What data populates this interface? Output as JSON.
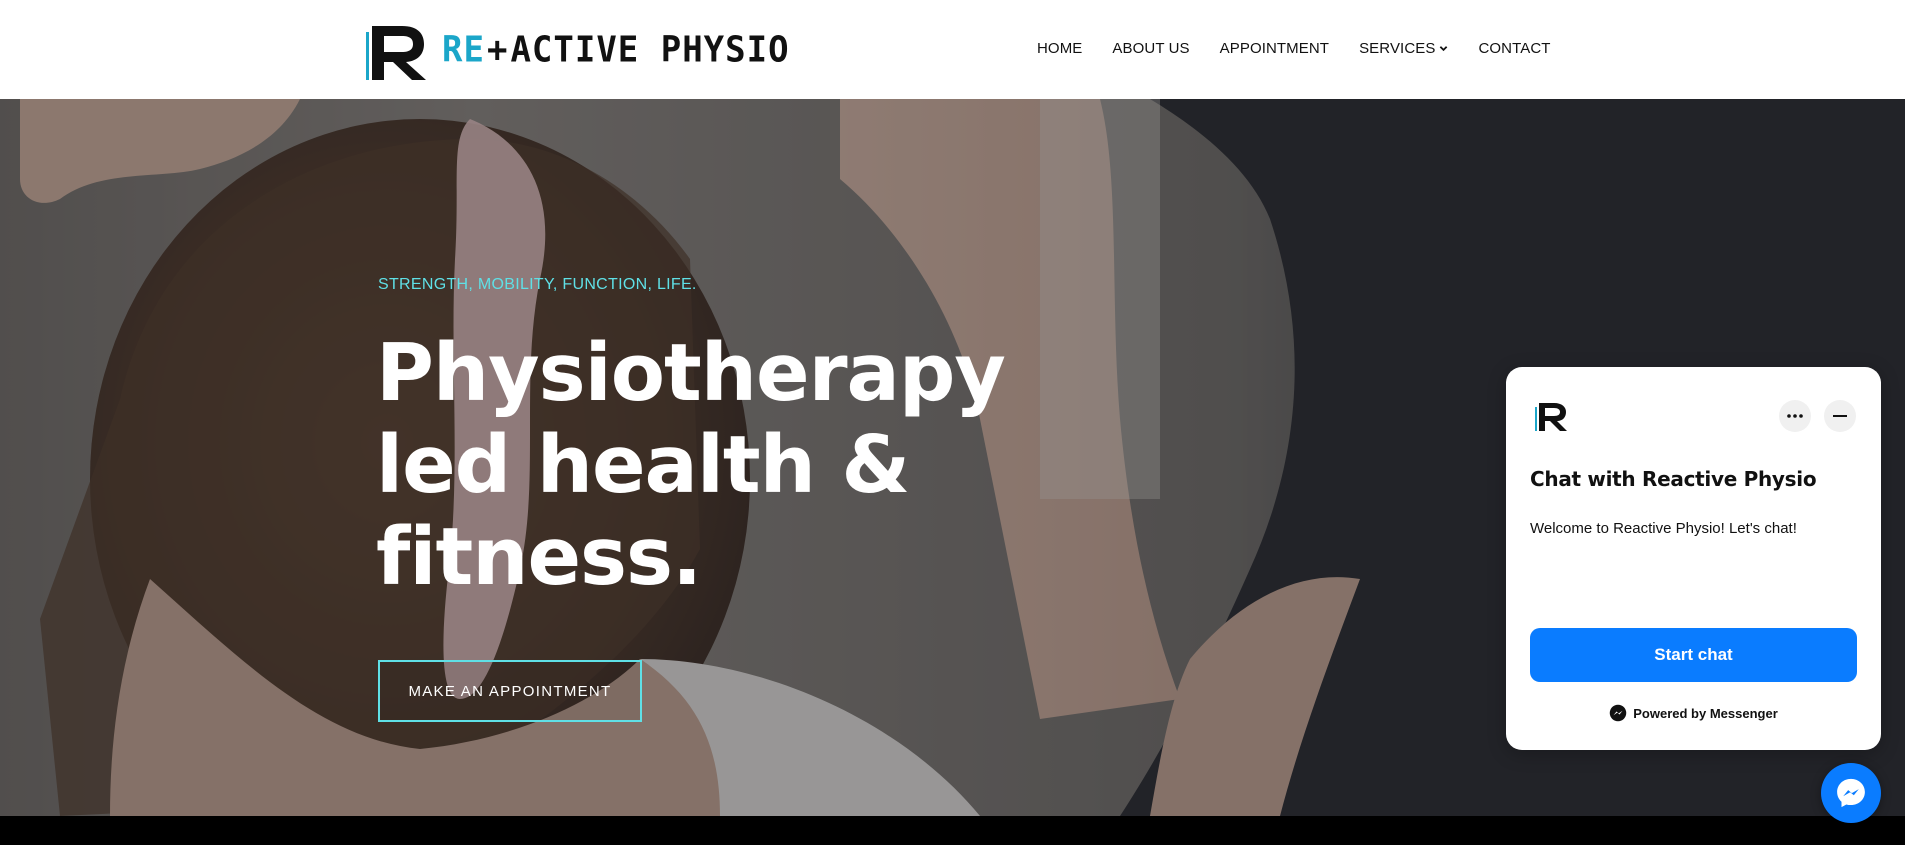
{
  "brand": {
    "logo_re": "RE",
    "logo_plus": "+",
    "logo_rest": "ACTIVE PHYSIO",
    "accent": "#1ba6c9"
  },
  "nav": {
    "items": [
      {
        "label": "HOME"
      },
      {
        "label": "ABOUT US"
      },
      {
        "label": "APPOINTMENT"
      },
      {
        "label": "SERVICES",
        "has_dropdown": true
      },
      {
        "label": "CONTACT"
      }
    ]
  },
  "hero": {
    "tagline": "STRENGTH, MOBILITY, FUNCTION, LIFE.",
    "headline_lines": [
      "Physiotherapy",
      "led health &",
      "fitness."
    ],
    "cta": "MAKE AN APPOINTMENT",
    "accent": "#5fe0e6"
  },
  "chat": {
    "title": "Chat with Reactive Physio",
    "welcome": "Welcome to Reactive Physio! Let's chat!",
    "start_label": "Start chat",
    "powered": "Powered by Messenger",
    "button_color": "#0a7cff",
    "icons": [
      "more-icon",
      "minimize-icon",
      "messenger-icon"
    ]
  }
}
